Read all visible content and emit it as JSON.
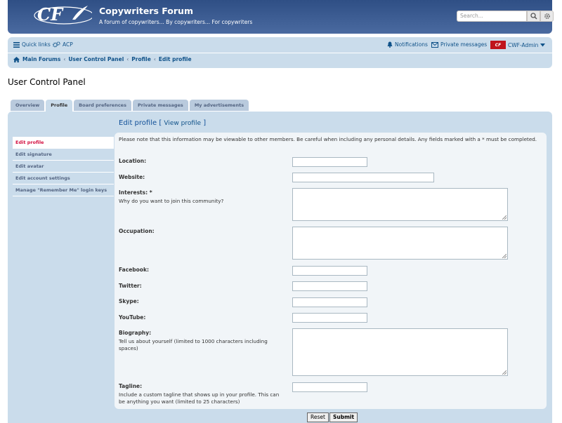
{
  "header": {
    "logo_text": "CF",
    "site_title": "Copywriters Forum",
    "site_description": "A forum of copywriters... By copywriters... For copywriters",
    "search_placeholder": "Search..."
  },
  "nav": {
    "quick_links": "Quick links",
    "acp": "ACP",
    "notifications": "Notifications",
    "private_messages": "Private messages",
    "username": "CWF-Admin",
    "avatar_text": "CF"
  },
  "breadcrumbs": [
    "Main Forums",
    "User Control Panel",
    "Profile",
    "Edit profile"
  ],
  "page_title": "User Control Panel",
  "tabs": [
    "Overview",
    "Profile",
    "Board preferences",
    "Private messages",
    "My advertisements"
  ],
  "active_tab": "Profile",
  "side_menu": [
    "Edit profile",
    "Edit signature",
    "Edit avatar",
    "Edit account settings",
    "Manage \"Remember Me\" login keys"
  ],
  "edit": {
    "heading": "Edit profile",
    "bracket_open": "[",
    "view_profile": "View profile",
    "bracket_close": "]",
    "notice": "Please note that this information may be viewable to other members. Be careful when including any personal details. Any fields marked with a * must be completed."
  },
  "fields": {
    "location": "Location:",
    "website": "Website:",
    "interests": "Interests: *",
    "interests_exp": "Why do you want to join this community?",
    "occupation": "Occupation:",
    "facebook": "Facebook:",
    "twitter": "Twitter:",
    "skype": "Skype:",
    "youtube": "YouTube:",
    "biography": "Biography:",
    "biography_exp": "Tell us about yourself (limited to 1000 characters including spaces)",
    "tagline": "Tagline:",
    "tagline_exp": "Include a custom tagline that shows up in your profile. This can be anything you want (limited to 25 characters)"
  },
  "buttons": {
    "reset": "Reset",
    "submit": "Submit"
  },
  "colors": {
    "header": "#3e5c8e",
    "panel": "#cadceb",
    "link": "#105289",
    "active_menu": "#d31141"
  },
  "icons": [
    "hamburger-icon",
    "gears-icon",
    "bell-icon",
    "envelope-icon",
    "search-icon",
    "gear-icon",
    "home-icon",
    "caret-down-icon"
  ]
}
